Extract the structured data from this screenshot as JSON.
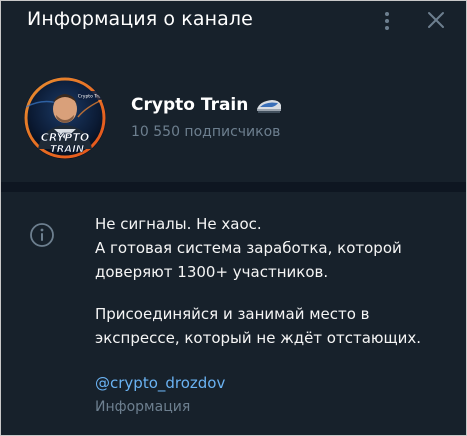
{
  "header": {
    "title": "Информация о канале",
    "more_icon": "kebab-vertical-icon",
    "close_icon": "close-icon"
  },
  "channel": {
    "name": "Crypto Train",
    "subscribers": "10 550 подписчиков",
    "avatar_text_line1": "CRYPTO",
    "avatar_text_line2": "TRAIN",
    "avatar_badge": "Crypto Trai"
  },
  "info": {
    "line1": "Не сигналы. Не хаос.",
    "line2": "А готовая система заработка, которой",
    "line3": "доверяют 1300+ участников.",
    "line4": "Присоединяйся и занимай место в",
    "line5": "экспрессе, который не ждёт отстающих.",
    "username": "@crypto_drozdov",
    "username_label": "Информация"
  },
  "colors": {
    "background": "#17212b",
    "divider": "#0e1621",
    "accent_link": "#6ab2f2",
    "muted_text": "#6d7f8f",
    "primary_text": "#f5f5f5"
  }
}
